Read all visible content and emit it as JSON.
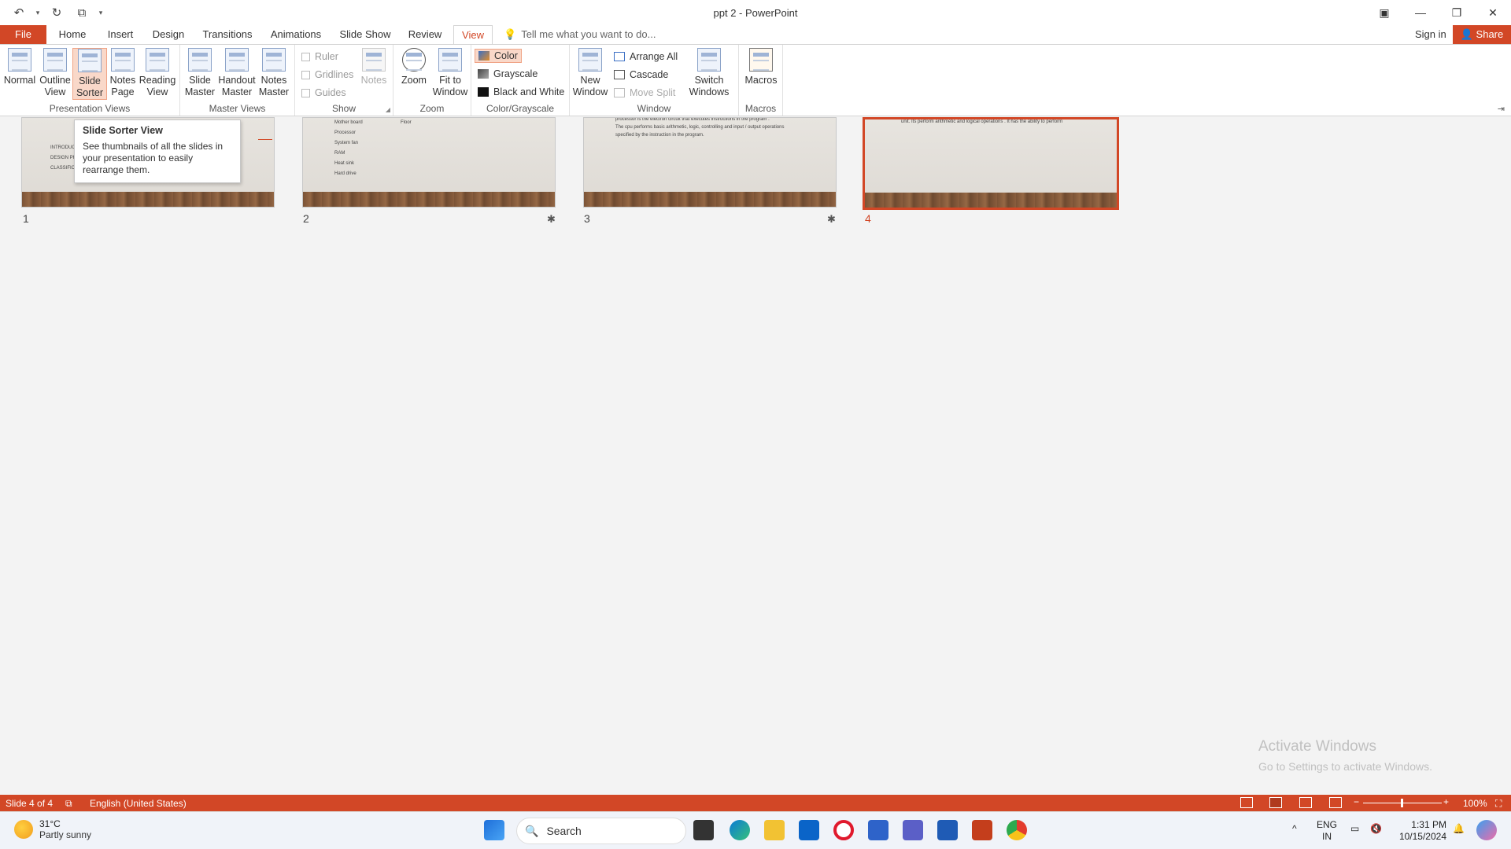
{
  "window": {
    "title": "ppt 2 - PowerPoint",
    "controls": [
      "ribbon-display-icon",
      "minimize-icon",
      "restore-icon",
      "close-icon"
    ]
  },
  "tabs": {
    "file": "File",
    "items": [
      "Home",
      "Insert",
      "Design",
      "Transitions",
      "Animations",
      "Slide Show",
      "Review",
      "View"
    ],
    "active": "View",
    "tell_me": "Tell me what you want to do...",
    "sign_in": "Sign in",
    "share": "Share"
  },
  "ribbon": {
    "presentation_views": {
      "label": "Presentation Views",
      "normal": "Normal",
      "outline": "Outline View",
      "slide_sorter": "Slide Sorter",
      "notes_page": "Notes Page",
      "reading_view": "Reading View"
    },
    "master_views": {
      "label": "Master Views",
      "slide_master": "Slide Master",
      "handout_master": "Handout Master",
      "notes_master": "Notes Master"
    },
    "show": {
      "label": "Show",
      "ruler": "Ruler",
      "gridlines": "Gridlines",
      "guides": "Guides",
      "notes": "Notes"
    },
    "zoom": {
      "label": "Zoom",
      "zoom": "Zoom",
      "fit": "Fit to Window"
    },
    "color": {
      "label": "Color/Grayscale",
      "color": "Color",
      "grayscale": "Grayscale",
      "bw": "Black and White"
    },
    "window": {
      "label": "Window",
      "new_window": "New Window",
      "arrange_all": "Arrange All",
      "cascade": "Cascade",
      "move_split": "Move Split",
      "switch": "Switch Windows"
    },
    "macros": {
      "label": "Macros",
      "macros": "Macros"
    }
  },
  "tooltip": {
    "title": "Slide Sorter View",
    "body": "See thumbnails of all the slides in your presentation to easily rearrange them."
  },
  "slides": [
    {
      "number": "1",
      "lines": [
        "INTRODUCTION",
        "DESIGN PHASE",
        "CLASSIFICATION"
      ],
      "selected": false,
      "star": false
    },
    {
      "number": "2",
      "lines": [
        "Mother board",
        "Processor",
        "System fan",
        "RAM",
        "Heat sink",
        "Hard drive"
      ],
      "lines2": [
        "Floor"
      ],
      "selected": false,
      "star": true
    },
    {
      "number": "3",
      "lines": [
        "processor is the electron circuit that executes instructions in the program .",
        "The cpu performs basic arithmetic, logic, controlling and input / output operations",
        "specified by the instruction in the program."
      ],
      "selected": false,
      "star": true
    },
    {
      "number": "4",
      "lines": [
        "unit. Its perform arithmetic and logical operations . It has the ability to perform"
      ],
      "selected": true,
      "star": false
    }
  ],
  "activation": {
    "line1": "Activate Windows",
    "line2": "Go to Settings to activate Windows."
  },
  "status": {
    "slide": "Slide 4 of 4",
    "language": "English (United States)",
    "zoom": "100%"
  },
  "taskbar": {
    "temp": "31°C",
    "condition": "Partly sunny",
    "search": "Search",
    "lang1": "ENG",
    "lang2": "IN",
    "time": "1:31 PM",
    "date": "10/15/2024"
  },
  "colors": {
    "accent": "#d24726",
    "ribbon_bg": "#ffffff",
    "workspace_bg": "#f3f3f3"
  }
}
